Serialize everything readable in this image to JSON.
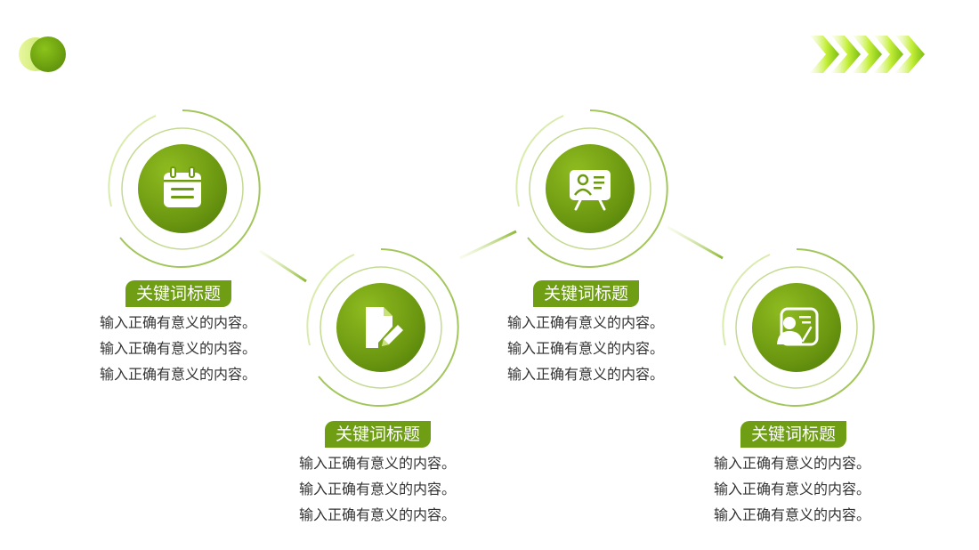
{
  "colors": {
    "accent": "#7aa61a",
    "accent_light": "#c8f04a",
    "accent_dark": "#4e7a08",
    "text": "#333333"
  },
  "steps": [
    {
      "icon": "calendar-icon",
      "title": "关键词标题",
      "lines": [
        "输入正确有意义的内容。",
        "输入正确有意义的内容。",
        "输入正确有意义的内容。"
      ]
    },
    {
      "icon": "edit-document-icon",
      "title": "关键词标题",
      "lines": [
        "输入正确有意义的内容。",
        "输入正确有意义的内容。",
        "输入正确有意义的内容。"
      ]
    },
    {
      "icon": "presentation-board-icon",
      "title": "关键词标题",
      "lines": [
        "输入正确有意义的内容。",
        "输入正确有意义的内容。",
        "输入正确有意义的内容。"
      ]
    },
    {
      "icon": "teacher-icon",
      "title": "关键词标题",
      "lines": [
        "输入正确有意义的内容。",
        "输入正确有意义的内容。",
        "输入正确有意义的内容。"
      ]
    }
  ]
}
